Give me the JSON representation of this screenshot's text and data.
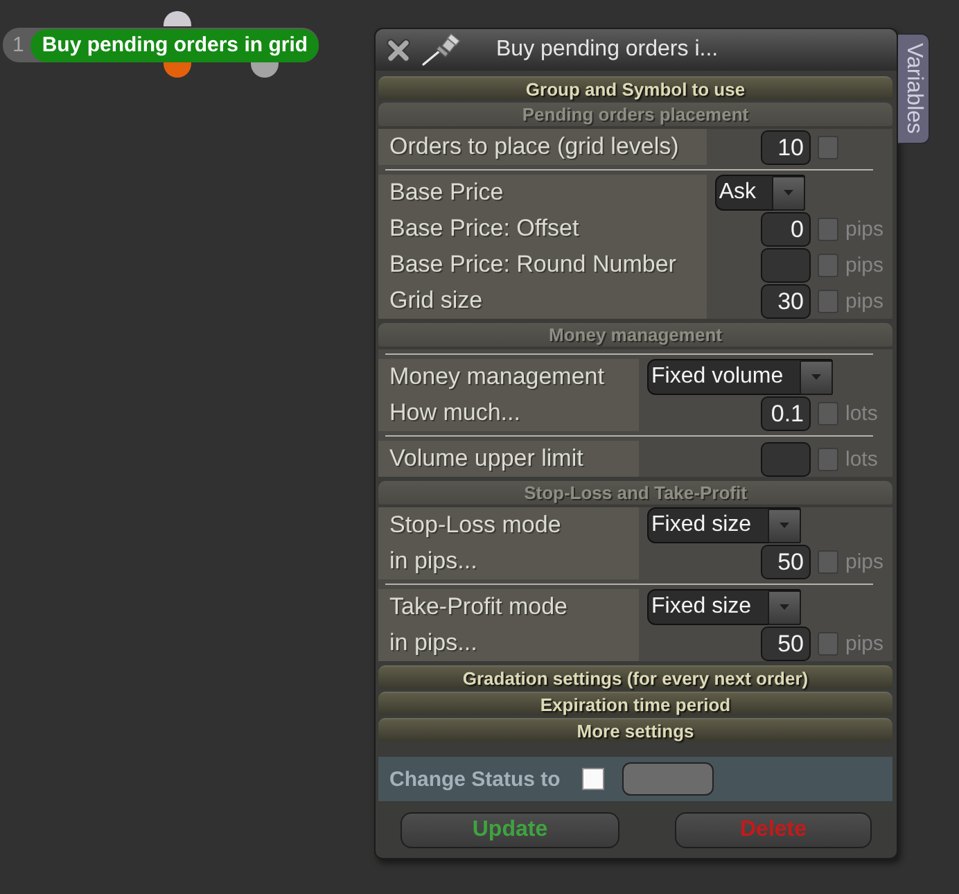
{
  "canvas": {
    "node": {
      "index": "1",
      "title": "Buy pending orders in grid",
      "connectors": [
        {
          "kind": "top",
          "color": "#cfcbd3"
        },
        {
          "kind": "bottom",
          "color": "#e3600c"
        },
        {
          "kind": "bottom",
          "color": "#a3a3a3"
        }
      ]
    }
  },
  "window": {
    "title": "Buy pending orders i...",
    "side_tab": "Variables",
    "sections": [
      {
        "title": "Group and Symbol to use",
        "expanded": false
      },
      {
        "title": "Pending orders placement",
        "expanded": true,
        "groups": [
          {
            "divider_above": false,
            "rows": [
              {
                "kind": "number",
                "label": "Orders to place (grid levels)",
                "value": "10",
                "checked": false
              }
            ]
          },
          {
            "divider_above": true,
            "rows": [
              {
                "kind": "select",
                "label": "Base Price",
                "value": "Ask"
              },
              {
                "kind": "number",
                "label": "Base Price: Offset",
                "value": "0",
                "checked": false,
                "unit": "pips"
              },
              {
                "kind": "number",
                "label": "Base Price: Round Number",
                "checked": false,
                "unit": "pips"
              },
              {
                "kind": "number",
                "label": "Grid size",
                "value": "30",
                "checked": false,
                "unit": "pips"
              }
            ]
          }
        ]
      },
      {
        "title": "Money management",
        "expanded": true,
        "groups": [
          {
            "divider_above": true,
            "rows": [
              {
                "kind": "select",
                "label": "Money management",
                "value": "Fixed volume"
              },
              {
                "kind": "number",
                "label": "How much...",
                "value": "0.1",
                "checked": false,
                "unit": "lots"
              }
            ]
          },
          {
            "divider_above": true,
            "rows": [
              {
                "kind": "number",
                "label": "Volume upper limit",
                "checked": false,
                "unit": "lots"
              }
            ]
          }
        ]
      },
      {
        "title": "Stop-Loss and Take-Profit",
        "expanded": true,
        "groups": [
          {
            "divider_above": false,
            "rows": [
              {
                "kind": "select",
                "label": "Stop-Loss mode",
                "value": "Fixed size"
              },
              {
                "kind": "number",
                "label": "in pips...",
                "value": "50",
                "checked": false,
                "unit": "pips"
              }
            ]
          },
          {
            "divider_above": true,
            "rows": [
              {
                "kind": "select",
                "label": "Take-Profit mode",
                "value": "Fixed size"
              },
              {
                "kind": "number",
                "label": "in pips...",
                "value": "50",
                "checked": false,
                "unit": "pips"
              }
            ]
          }
        ]
      },
      {
        "title": "Gradation settings (for every next order)",
        "expanded": false
      },
      {
        "title": "Expiration time period",
        "expanded": false
      },
      {
        "title": "More settings",
        "expanded": false
      }
    ],
    "status": {
      "label": "Change Status to",
      "checked": false
    },
    "buttons": [
      {
        "kind": "confirm",
        "label": "Update"
      },
      {
        "kind": "danger",
        "label": "Delete"
      }
    ]
  }
}
